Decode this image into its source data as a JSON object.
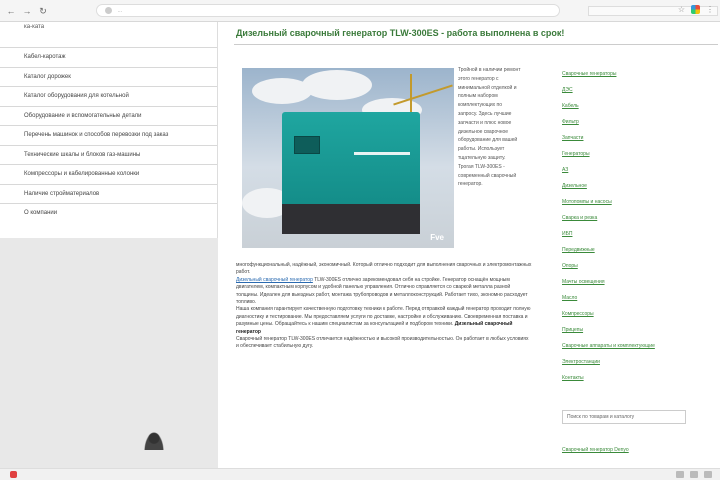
{
  "browser": {
    "url": "…",
    "back_icon": "back-icon",
    "forward_icon": "forward-icon",
    "reload_icon": "reload-icon"
  },
  "sidebar": {
    "header": "ка-ката",
    "items": [
      {
        "label": "Кабел-каротаж"
      },
      {
        "label": "Каталог дорожек"
      },
      {
        "label": "Каталог оборудования для котельной"
      },
      {
        "label": "Оборудование и вспомогательные детали"
      },
      {
        "label": "Перечень машинок и способов перевозки под заказ"
      },
      {
        "label": "Технические шкалы и блоков газ-машины"
      },
      {
        "label": "Компрессоры и кабелированные колонки"
      },
      {
        "label": "Наличие стройматериалов"
      },
      {
        "label": "О компании"
      }
    ]
  },
  "main": {
    "title": "Дизельный сварочный генератор TLW-300ES - работа выполнена в срок!",
    "photo_logo": "Fve",
    "side_text": "Тройной в наличии ремонт этого генератор с минимальной отделкой и полным набором комплектующих по запросу. Здесь лучшие запчасти и плюс новое дизельное сварочное оборудование для вашей работы. Использует тщательную защиту. Трогая TLW-300ES - современный сварочный генератор.",
    "body_paragraphs": [
      {
        "text": "многофункциональный, надёжный, экономичный. Который отлично подходит для выполнения сварочных и электромонтажных работ."
      },
      {
        "link": "Дизельный сварочный генератор",
        "text": " TLW-300ES отлично зарекомендовал себя на стройке. Генератор оснащён мощным двигателем, компактным корпусом и удобной панелью управления. Отлично справляется со сваркой металла разной толщины. Идеален для выездных работ, монтажа трубопроводов и металлоконструкций. Работает тихо, экономно расходует топливо."
      },
      {
        "text": "Наша компания гарантирует качественную подготовку техники к работе. Перед отправкой каждый генератор проходит полную диагностику и тестирование. Мы предоставляем услуги по доставке, настройке и обслуживанию. Своевременная поставка и разумные цены. Обращайтесь к нашим специалистам за консультацией и подбором техники.",
        "bold": "Дизельный сварочный генератор"
      },
      {
        "text": "Сварочный генератор TLW-300ES отличается надёжностью и высокой производительностью. Он работает в любых условиях и обеспечивает стабильную дугу."
      }
    ],
    "right_links": [
      {
        "label": "Сварочные генераторы"
      },
      {
        "label": "ДЭС"
      },
      {
        "label": "Кабель"
      },
      {
        "label": "Фильтр"
      },
      {
        "label": "Запчасти"
      },
      {
        "label": "Генераторы"
      },
      {
        "label": "АЗ"
      },
      {
        "label": "Дизельное"
      },
      {
        "label": "Мотопомпы и насосы"
      },
      {
        "label": "Сварка и резка"
      },
      {
        "label": "ИБП"
      },
      {
        "label": "Передвижные"
      },
      {
        "label": "Опоры"
      },
      {
        "label": "Мачты освещения"
      },
      {
        "label": "Масло"
      },
      {
        "label": "Компрессоры"
      },
      {
        "label": "Прицепы"
      },
      {
        "label": "Сварочные аппараты и комплектующие"
      },
      {
        "label": "Электростанции"
      },
      {
        "label": "Контакты"
      }
    ],
    "search_box": "Поиск по товарам и каталогу",
    "bottom_link": "Сварочный генератор Denyo"
  }
}
